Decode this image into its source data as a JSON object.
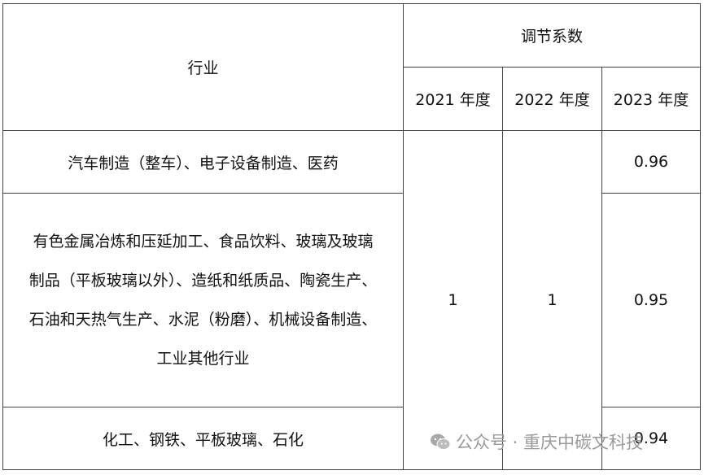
{
  "table": {
    "header": {
      "industry": "行业",
      "coefficient": "调节系数",
      "years": [
        "2021 年度",
        "2022 年度",
        "2023 年度"
      ]
    },
    "rows": [
      {
        "industry": "汽车制造（整车）、电子设备制造、医药",
        "y2023": "0.96"
      },
      {
        "industry_lines": [
          "有色金属冶炼和压延加工、食品饮料、玻璃及玻璃",
          "制品（平板玻璃以外）、造纸和纸质品、陶瓷生产、",
          "石油和天热气生产、水泥（粉磨）、机械设备制造、",
          "工业其他行业"
        ],
        "y2023": "0.95"
      },
      {
        "industry": "化工、钢铁、平板玻璃、石化",
        "y2023": "0.94"
      }
    ],
    "merged": {
      "y2021": "1",
      "y2022": "1"
    }
  },
  "watermark": {
    "icon": "wechat-icon",
    "text": "公众号 · 重庆中碳文科技"
  }
}
